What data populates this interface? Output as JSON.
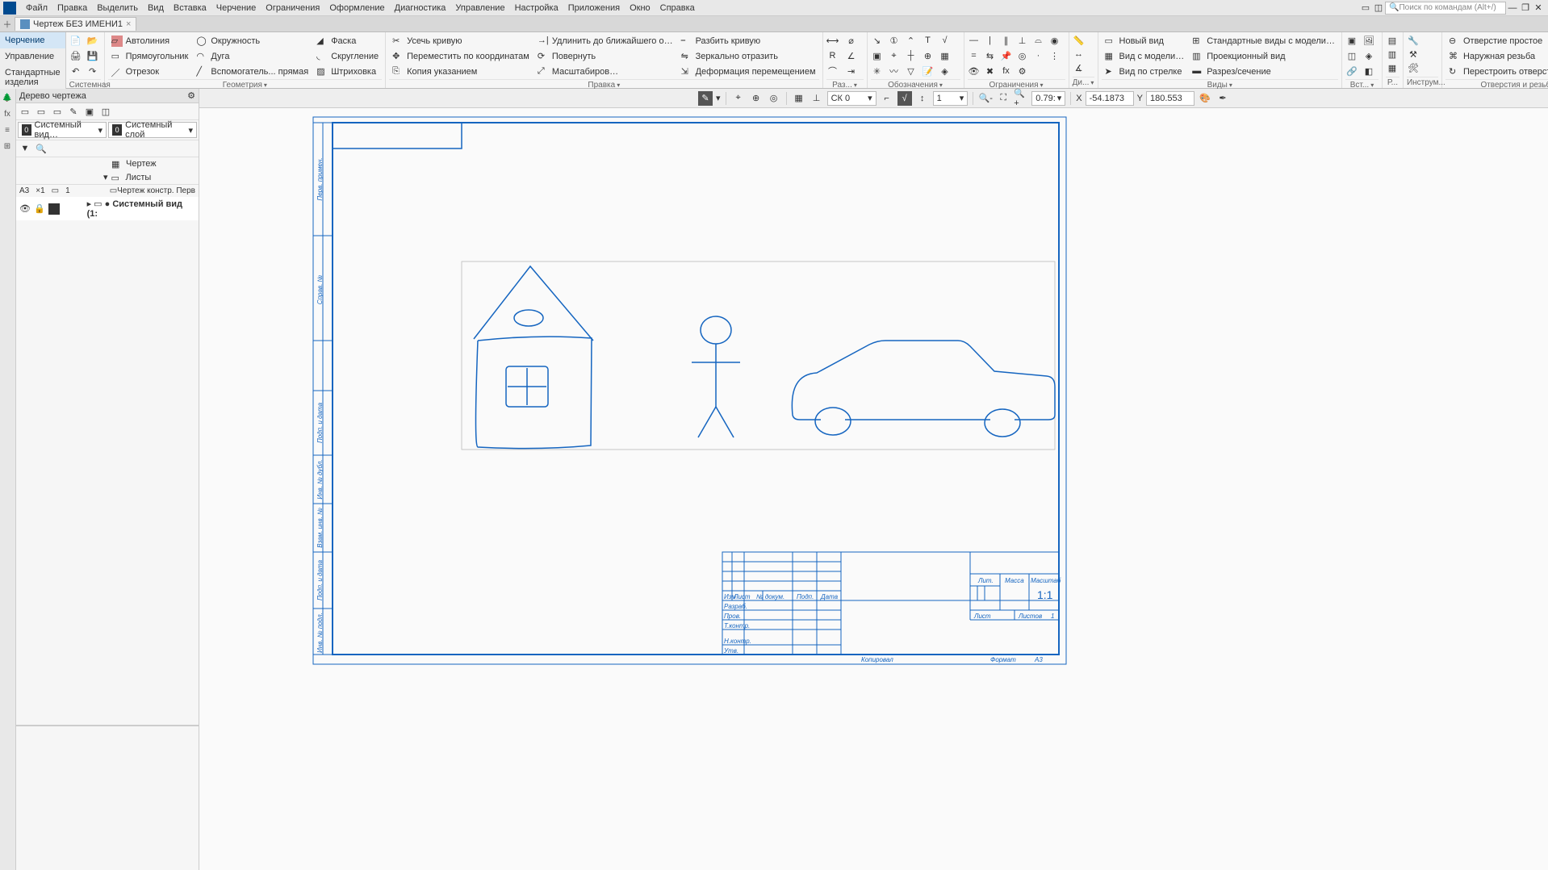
{
  "menu": {
    "items": [
      "Файл",
      "Правка",
      "Выделить",
      "Вид",
      "Вставка",
      "Черчение",
      "Ограничения",
      "Оформление",
      "Диагностика",
      "Управление",
      "Настройка",
      "Приложения",
      "Окно",
      "Справка"
    ],
    "search_placeholder": "Поиск по командам (Alt+/)"
  },
  "tab": {
    "title": "Чертеж БЕЗ ИМЕНИ1"
  },
  "left_tabs": {
    "active": "Черчение",
    "t2": "Управление",
    "t3": "Стандартные изделия"
  },
  "ribbon": {
    "group_system": "Системная",
    "group_geom": "Геометрия",
    "group_edit": "Правка",
    "group_dim": "Раз...",
    "group_labels": "Обозначения",
    "group_constr": "Ограничения",
    "group_diag": "Ди...",
    "group_views": "Виды",
    "group_insert": "Вст...",
    "group_p": "Р...",
    "group_instr": "Инструм...",
    "group_holes": "Отверстия и резьбы",
    "autoline": "Автолиния",
    "rect": "Прямоугольник",
    "segment": "Отрезок",
    "circle": "Окружность",
    "arc": "Дуга",
    "auxline": "Вспомогатель... прямая",
    "chamfer": "Фаска",
    "fillet": "Скругление",
    "hatch": "Штриховка",
    "trim": "Усечь кривую",
    "moveby": "Переместить по координатам",
    "copy": "Копия указанием",
    "extend": "Удлинить до ближайшего о…",
    "rotate": "Повернуть",
    "scale": "Масштабиров…",
    "split": "Разбить кривую",
    "mirror": "Зеркально отразить",
    "deform": "Деформация перемещением",
    "newview": "Новый вид",
    "modelview": "Вид с модели…",
    "arrowview": "Вид по стрелке",
    "stdviews": "Стандартные виды с модели…",
    "projview": "Проекционный вид",
    "section": "Разрез/сечение",
    "hole_simple": "Отверстие простое",
    "thread_ext": "Наружная резьба",
    "rebuild": "Перестроить отверстия и из…"
  },
  "tree": {
    "title": "Дерево чертежа",
    "sel1": "Системный вид…",
    "sel2": "Системный слой",
    "n1": "Чертеж",
    "n2": "Листы",
    "n3": "Чертеж констр. Перв",
    "n4": "Системный вид (1:",
    "a3": "А3",
    "x1": "×1",
    "one": "1"
  },
  "canvas_tb": {
    "layer": "СК 0",
    "scale": "1",
    "zoom": "0.79:",
    "x": "-54.1873",
    "y": "180.553",
    "xlabel": "X",
    "ylabel": "Y"
  },
  "titleblock": {
    "lit": "Лит.",
    "massa": "Масса",
    "masht": "Масштаб",
    "scale": "1:1",
    "list": "Лист",
    "listov": "Листов",
    "listov_n": "1",
    "izm": "Изм",
    "list2": "Лист",
    "ndok": "№ докум.",
    "podp": "Подп.",
    "data": "Дата",
    "razrab": "Разраб.",
    "prov": "Пров.",
    "tkontr": "Т.контр.",
    "nkontr": "Н.контр.",
    "utv": "Утв.",
    "kopiroval": "Копировал",
    "format": "Формат",
    "a3": "А3"
  },
  "side_labels": [
    "Перв. примен.",
    "Справ. №",
    "Подп. и дата",
    "Инв. № дубл.",
    "Взам. инв. №",
    "Подп. и дата",
    "Инв. № подл."
  ]
}
